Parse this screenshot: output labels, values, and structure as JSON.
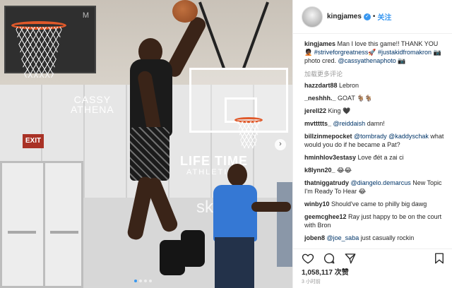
{
  "post": {
    "watermark_top": "CASSY",
    "watermark_bottom": "ATHENA",
    "banner_letter": "M",
    "exit_sign": "EXIT",
    "wall_logo_top": "LIFE TIME",
    "wall_logo_bottom": "ATHLETIC",
    "wall_text": "sk",
    "carousel_next": "›"
  },
  "header": {
    "username": "kingjames",
    "verified_mark": "✓",
    "separator": "•",
    "follow_label": "关注"
  },
  "caption": {
    "user": "kingjames",
    "text_1": " Man I love this game!! THANK YOU 🤦🏿 ",
    "tag_1": "#striveforgreatness",
    "text_2": "🚀 ",
    "tag_2": "#justakidfromakron",
    "text_3": " 📷 photo cred. ",
    "mention": "@cassyathenaphoto",
    "text_4": " 📷"
  },
  "load_more": "加载更多评论",
  "comments": [
    {
      "user": "hazzdart88",
      "pre": "",
      "mention": "",
      "text": " Lebron"
    },
    {
      "user": "_neshhh._",
      "pre": "",
      "mention": "",
      "text": " GOAT 🐐🐐"
    },
    {
      "user": "jerell22",
      "pre": "",
      "mention": "",
      "text": " King 🖤"
    },
    {
      "user": "mvttttts_",
      "pre": " ",
      "mention": "@reiddaish",
      "text": " damn!"
    },
    {
      "user": "billzinmepocket",
      "pre": " ",
      "mention": "@tombrady @kaddyschak",
      "text": " what would you do if he became a Pat?"
    },
    {
      "user": "hminhlov3estasy",
      "pre": "",
      "mention": "",
      "text": " Love đét a zai ci"
    },
    {
      "user": "k8lynn20_",
      "pre": "",
      "mention": "",
      "text": " 😂😂"
    },
    {
      "user": "thatniggatrudy",
      "pre": " ",
      "mention": "@diangelo.demarcus",
      "text": " New Topic I'm Ready To Hear 😂"
    },
    {
      "user": "winby10",
      "pre": "",
      "mention": "",
      "text": " Should've came to philly big dawg"
    },
    {
      "user": "geemcghee12",
      "pre": "",
      "mention": "",
      "text": " Ray just happy to be on the court with Bron"
    },
    {
      "user": "joben8",
      "pre": " ",
      "mention": "@joe_saba",
      "text": " just casually rockin"
    }
  ],
  "likes": "1,058,117 次赞",
  "timestamp": "3 小时前"
}
